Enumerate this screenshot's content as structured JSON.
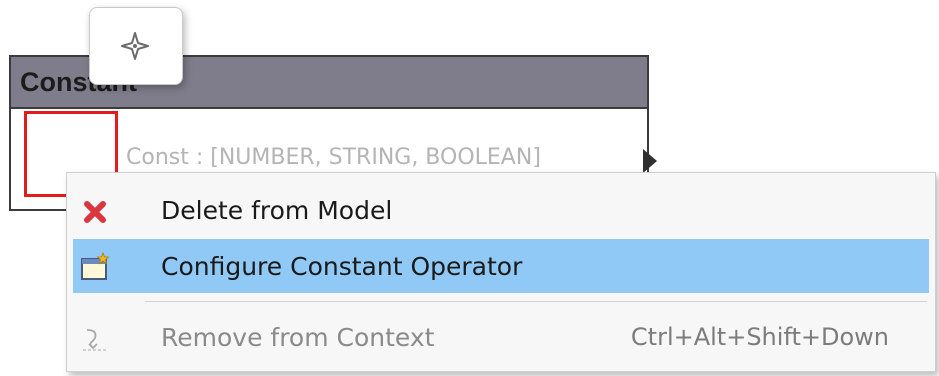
{
  "node": {
    "title": "Constant",
    "output_label": "Const : [NUMBER, STRING, BOOLEAN]"
  },
  "tool_popup": {
    "icon": "move-cursor-icon"
  },
  "context_menu": {
    "items": [
      {
        "label": "Delete from Model",
        "icon": "delete-x-icon",
        "shortcut": "",
        "enabled": true,
        "highlighted": false
      },
      {
        "label": "Configure Constant Operator",
        "icon": "configure-window-icon",
        "shortcut": "",
        "enabled": true,
        "highlighted": true
      },
      {
        "label": "Remove from Context",
        "icon": "remove-from-context-icon",
        "shortcut": "Ctrl+Alt+Shift+Down",
        "enabled": false,
        "highlighted": false
      }
    ]
  },
  "colors": {
    "node_header": "#7f7d8b",
    "selection_border": "#e21b1b",
    "menu_highlight": "#90c8f6",
    "delete_icon": "#d9363e"
  }
}
